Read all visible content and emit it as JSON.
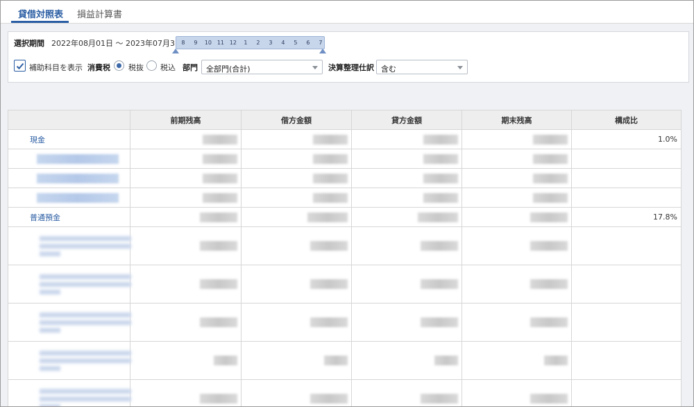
{
  "tabs": [
    {
      "label": "貸借対照表",
      "active": true
    },
    {
      "label": "損益計算書",
      "active": false
    }
  ],
  "filters": {
    "period_label": "選択期間",
    "period_value": "2022年08月01日 ～ 2023年07月31日",
    "months": [
      "8",
      "9",
      "10",
      "11",
      "12",
      "1",
      "2",
      "3",
      "4",
      "5",
      "6",
      "7"
    ],
    "show_sub_accounts_label": "補助科目を表示",
    "show_sub_accounts_checked": true,
    "tax_label": "消費税",
    "tax_options": [
      {
        "label": "税抜",
        "selected": true
      },
      {
        "label": "税込",
        "selected": false
      }
    ],
    "department_label": "部門",
    "department_value": "全部門(合計)",
    "closing_label": "決算整理仕訳",
    "closing_value": "含む"
  },
  "table": {
    "headers": [
      "",
      "前期残高",
      "借方金額",
      "貸方金額",
      "期末残高",
      "構成比"
    ],
    "rows": [
      {
        "name": "現金",
        "ratio": "1.0%",
        "type": "account"
      },
      {
        "name": "",
        "ratio": "",
        "type": "sub"
      },
      {
        "name": "",
        "ratio": "",
        "type": "sub"
      },
      {
        "name": "",
        "ratio": "",
        "type": "sub"
      },
      {
        "name": "普通預金",
        "ratio": "17.8%",
        "type": "account"
      },
      {
        "name": "",
        "ratio": "",
        "type": "sub-tall"
      },
      {
        "name": "",
        "ratio": "",
        "type": "sub-tall"
      },
      {
        "name": "",
        "ratio": "",
        "type": "sub-tall"
      },
      {
        "name": "",
        "ratio": "",
        "type": "sub-tall"
      },
      {
        "name": "",
        "ratio": "",
        "type": "sub-tall"
      }
    ]
  },
  "colors": {
    "accent": "#2a5da3",
    "background": "#eff1f4"
  }
}
